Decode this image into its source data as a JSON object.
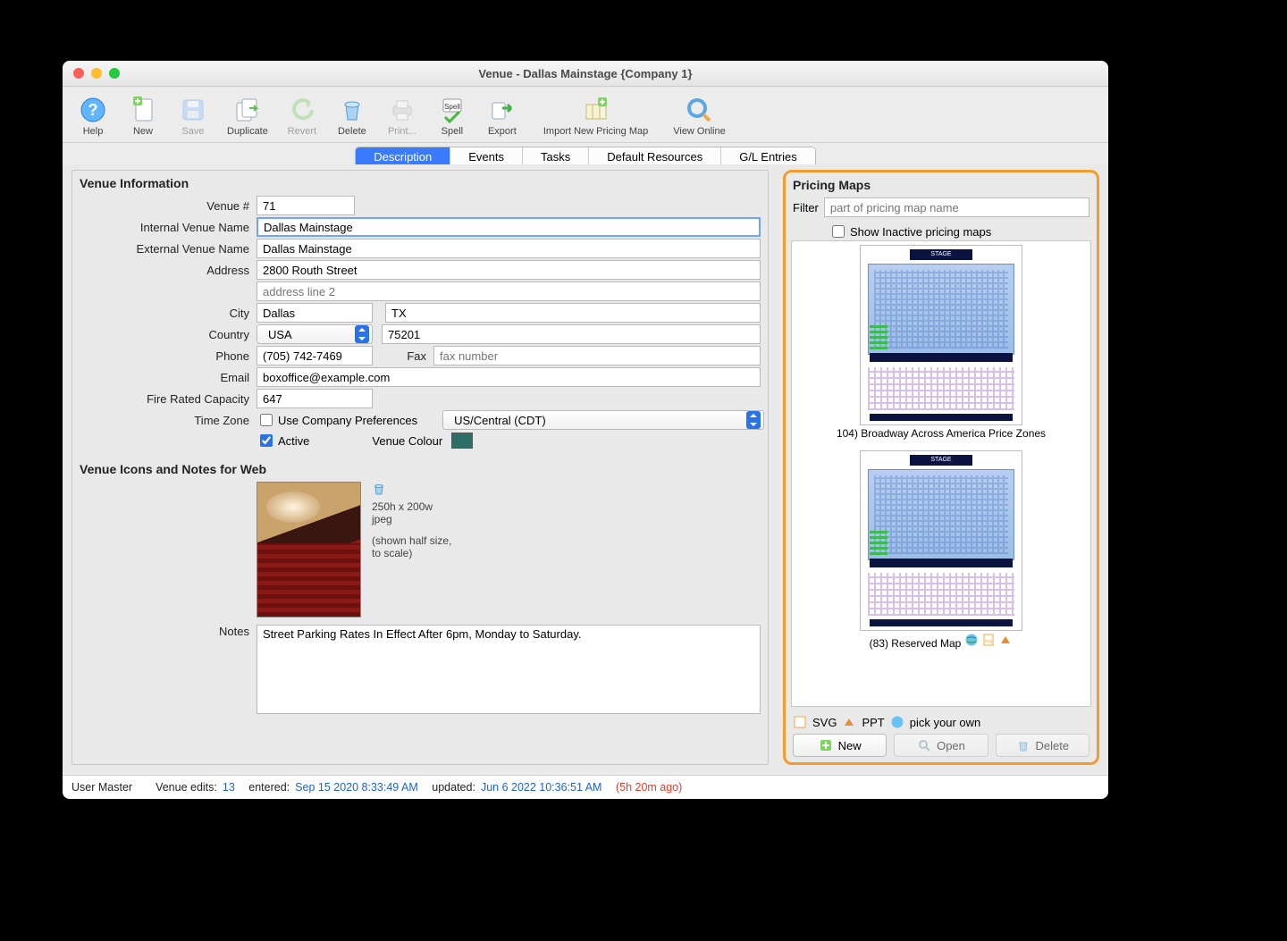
{
  "window": {
    "title": "Venue - Dallas Mainstage {Company 1}"
  },
  "toolbar": {
    "help": "Help",
    "new": "New",
    "save": "Save",
    "duplicate": "Duplicate",
    "revert": "Revert",
    "delete": "Delete",
    "print": "Print...",
    "spell": "Spell",
    "export": "Export",
    "import_map": "Import New Pricing Map",
    "view_online": "View Online"
  },
  "tabs": [
    "Description",
    "Events",
    "Tasks",
    "Default Resources",
    "G/L Entries"
  ],
  "active_tab": "Description",
  "venue_info": {
    "section_title": "Venue Information",
    "labels": {
      "venue_no": "Venue #",
      "internal": "Internal Venue Name",
      "external": "External Venue Name",
      "address": "Address",
      "city": "City",
      "country": "Country",
      "phone": "Phone",
      "fax": "Fax",
      "email": "Email",
      "capacity": "Fire Rated Capacity",
      "tz": "Time Zone",
      "use_company_prefs": "Use Company Preferences",
      "active": "Active",
      "venue_colour": "Venue Colour"
    },
    "values": {
      "venue_no": "71",
      "internal": "Dallas Mainstage",
      "external": "Dallas Mainstage",
      "address1": "2800 Routh Street",
      "address2_placeholder": "address line 2",
      "city": "Dallas",
      "state": "TX",
      "country": "USA",
      "postal": "75201",
      "phone": "(705) 742-7469",
      "fax_placeholder": "fax number",
      "email": "boxoffice@example.com",
      "capacity": "647",
      "tz_value": "US/Central (CDT)",
      "use_company_prefs_checked": false,
      "active_checked": true,
      "venue_colour": "#2d6e69"
    }
  },
  "icons_notes": {
    "section_title": "Venue Icons and Notes for Web",
    "img_meta1": "250h x 200w",
    "img_meta2": "jpeg",
    "img_meta3": "(shown half size,",
    "img_meta4": "to scale)",
    "notes_label": "Notes",
    "notes_value": "Street Parking Rates In Effect After 6pm, Monday to Saturday."
  },
  "pricing": {
    "title": "Pricing Maps",
    "filter_label": "Filter",
    "filter_placeholder": "part of pricing map name",
    "show_inactive": "Show Inactive pricing maps",
    "maps": [
      {
        "caption": "104) Broadway Across America Price Zones"
      },
      {
        "caption": "(83) Reserved Map"
      }
    ],
    "legend": {
      "svg": "SVG",
      "ppt": "PPT",
      "pyo": "pick your own"
    },
    "buttons": {
      "new": "New",
      "open": "Open",
      "delete": "Delete"
    }
  },
  "status": {
    "user": "User Master",
    "label_edits": "Venue edits:",
    "edits": "13",
    "entered_label": "entered:",
    "entered": "Sep 15 2020 8:33:49 AM",
    "updated_label": "updated:",
    "updated": "Jun 6 2022 10:36:51 AM",
    "ago": "(5h 20m ago)"
  }
}
